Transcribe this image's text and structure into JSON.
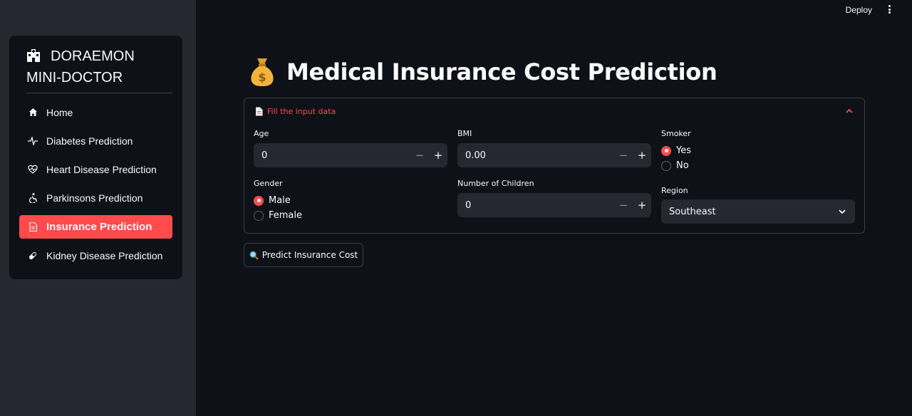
{
  "sidebar": {
    "brand_line1": "DORAEMON",
    "brand_line2": "MINI-DOCTOR",
    "brand_icon": "hospital-icon",
    "items": [
      {
        "label": "Home",
        "icon": "home-icon",
        "active": false
      },
      {
        "label": "Diabetes Prediction",
        "icon": "activity-icon",
        "active": false
      },
      {
        "label": "Heart Disease Prediction",
        "icon": "heart-pulse-icon",
        "active": false
      },
      {
        "label": "Parkinsons Prediction",
        "icon": "accessibility-icon",
        "active": false
      },
      {
        "label": "Insurance Prediction",
        "icon": "document-icon",
        "active": true
      },
      {
        "label": "Kidney Disease Prediction",
        "icon": "capsule-icon",
        "active": false
      }
    ]
  },
  "header": {
    "deploy_label": "Deploy",
    "menu_icon": "kebab-menu-icon"
  },
  "main": {
    "title": "Medical Insurance Cost Prediction",
    "title_icon": "money-bag-icon",
    "expander": {
      "label": "Fill the input data",
      "icon": "document-icon",
      "expanded": true
    },
    "fields": {
      "age": {
        "label": "Age",
        "value": "0"
      },
      "bmi": {
        "label": "BMI",
        "value": "0.00"
      },
      "children": {
        "label": "Number of Children",
        "value": "0"
      },
      "smoker": {
        "label": "Smoker",
        "options": [
          "Yes",
          "No"
        ],
        "selected": "Yes"
      },
      "gender": {
        "label": "Gender",
        "options": [
          "Male",
          "Female"
        ],
        "selected": "Male"
      },
      "region": {
        "label": "Region",
        "value": "Southeast"
      }
    },
    "stepper": {
      "minus": "−",
      "plus": "+"
    },
    "predict_button": "Predict Insurance Cost"
  },
  "colors": {
    "accent": "#ff4b4b",
    "background": "#0e1117",
    "sidebar": "#262730",
    "input": "#262730"
  }
}
